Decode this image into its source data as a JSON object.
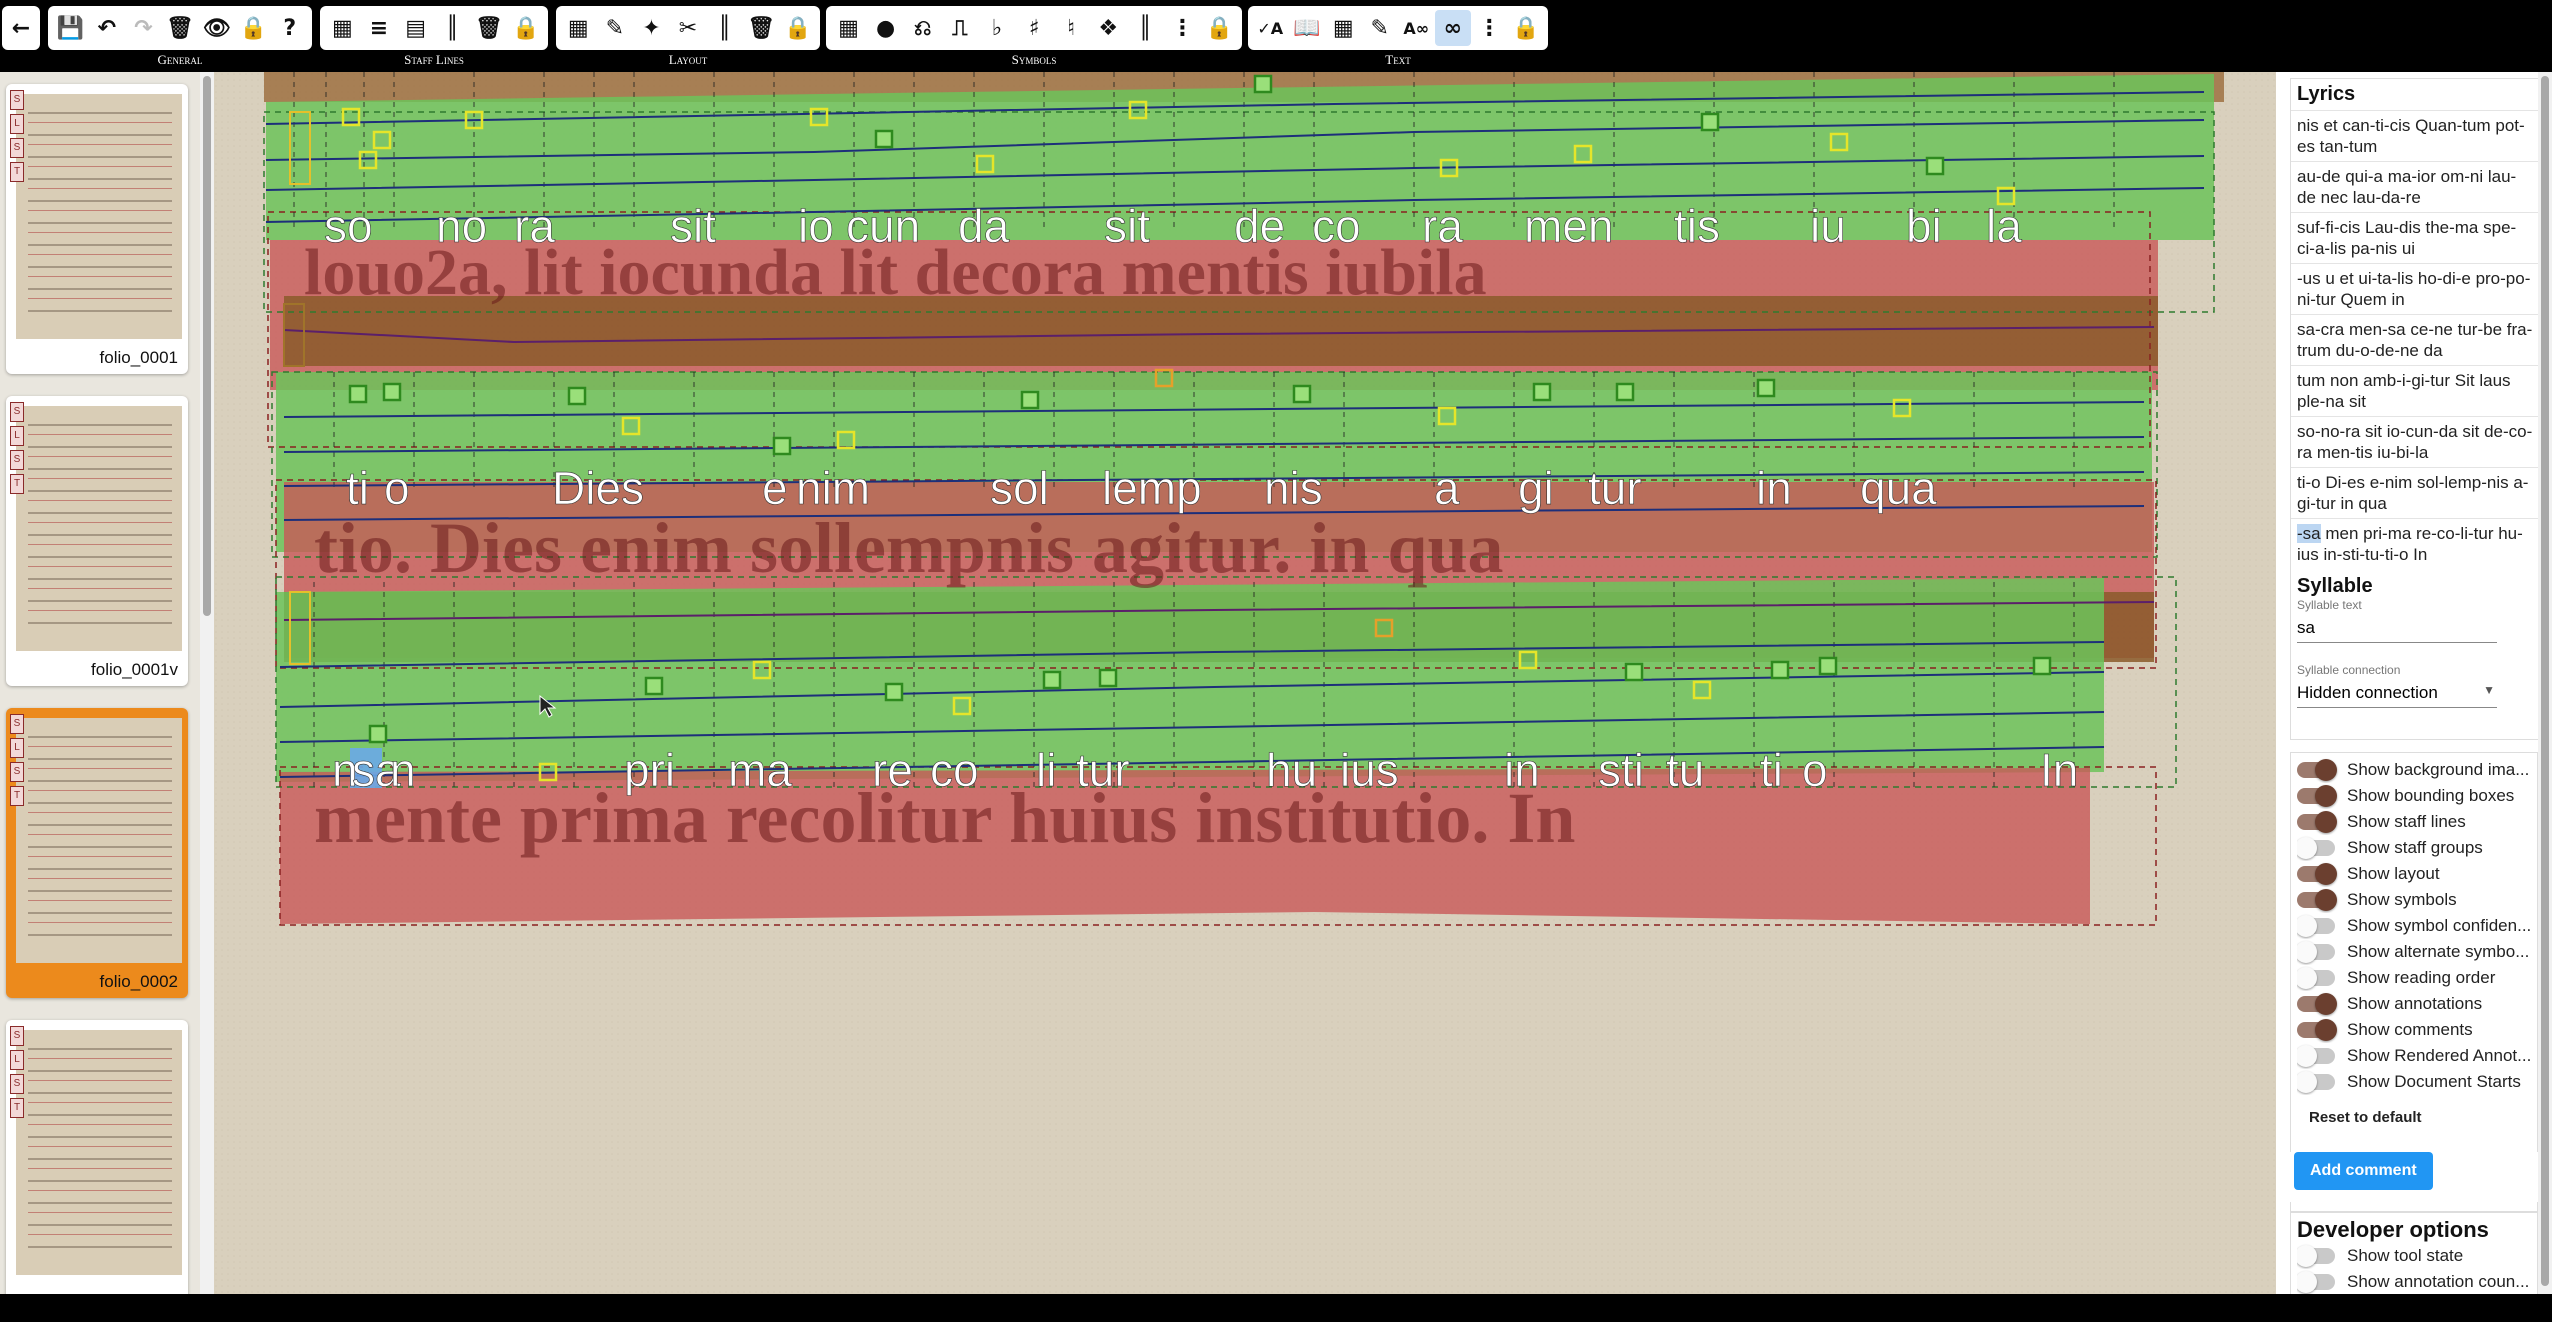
{
  "toolbar": {
    "groups": [
      {
        "label": "General"
      },
      {
        "label": "Staff Lines"
      },
      {
        "label": "Layout"
      },
      {
        "label": "Symbols"
      },
      {
        "label": "Text"
      }
    ]
  },
  "thumbnails": [
    {
      "name": "folio_0001",
      "selected": false
    },
    {
      "name": "folio_0001v",
      "selected": false
    },
    {
      "name": "folio_0002",
      "selected": true
    },
    {
      "name": "",
      "selected": false
    }
  ],
  "canvas": {
    "syllables_row1": [
      "so",
      "no",
      "ra",
      "sit",
      "io",
      "cun",
      "da",
      "sit",
      "de",
      "co",
      "ra",
      "men",
      "tis",
      "iu",
      "bi",
      "la"
    ],
    "syllables_row2": [
      "ti",
      "o",
      "Dies",
      "e",
      "nim",
      "sol",
      "lemp",
      "nis",
      "a",
      "gi",
      "tur",
      "in",
      "qua"
    ],
    "syllables_row3": [
      "n",
      "sa",
      "n",
      "pri",
      "ma",
      "re",
      "co",
      "li",
      "tur",
      "hu",
      "ius",
      "in",
      "sti",
      "tu",
      "ti",
      "o",
      "In"
    ],
    "manuscript_row1": "louo2a, lit iocunda lit decora mentis iubila",
    "manuscript_row2": "tio. Dies enim sollempnis agitur. in qua",
    "manuscript_row3": "mente prima recolitur huius institutio. In"
  },
  "panel": {
    "lyrics_title": "Lyrics",
    "lyrics": [
      "nis et can-ti-cis Quan-tum pot-es tan-tum",
      "au-de qui-a ma-ior om-ni lau-de nec lau-da-re",
      "suf-fi-cis Lau-dis the-ma spe-ci-a-lis pa-nis ui",
      "-us u et ui-ta-lis ho-di-e pro-po-ni-tur Quem in",
      "sa-cra men-sa ce-ne tur-be fra-trum du-o-de-ne da",
      "tum non amb-i-gi-tur Sit laus ple-na sit",
      "so-no-ra sit io-cun-da sit de-co-ra men-tis iu-bi-la",
      "ti-o Di-es e-nim sol-lemp-nis a-gi-tur in qua"
    ],
    "lyric_last_highlight": "-sa",
    "lyric_last_rest": " men pri-ma re-co-li-tur hu-ius in-sti-tu-ti-o In",
    "syllable_title": "Syllable",
    "syllable_text_label": "Syllable text",
    "syllable_text_value": "sa",
    "syllable_connection_label": "Syllable connection",
    "syllable_connection_value": "Hidden connection",
    "toggles": [
      {
        "label": "Show background ima...",
        "on": true
      },
      {
        "label": "Show bounding boxes",
        "on": true
      },
      {
        "label": "Show staff lines",
        "on": true
      },
      {
        "label": "Show staff groups",
        "on": false
      },
      {
        "label": "Show layout",
        "on": true
      },
      {
        "label": "Show symbols",
        "on": true
      },
      {
        "label": "Show symbol confiden...",
        "on": false
      },
      {
        "label": "Show alternate symbo...",
        "on": false
      },
      {
        "label": "Show reading order",
        "on": false
      },
      {
        "label": "Show annotations",
        "on": true
      },
      {
        "label": "Show comments",
        "on": true
      },
      {
        "label": "Show Rendered Annot...",
        "on": false
      },
      {
        "label": "Show Document Starts",
        "on": false
      }
    ],
    "reset_label": "Reset to default",
    "add_comment_label": "Add comment",
    "dev_title": "Developer options",
    "dev_toggles": [
      {
        "label": "Show tool state",
        "on": false
      },
      {
        "label": "Show annotation coun...",
        "on": false
      }
    ]
  },
  "colors": {
    "staff_green": "#5fbf4f",
    "text_red": "#c84a4a",
    "dropcap_brown": "#8a5a2a",
    "selected_thumb": "#ec8a1c",
    "accent_blue": "#2196f3"
  }
}
